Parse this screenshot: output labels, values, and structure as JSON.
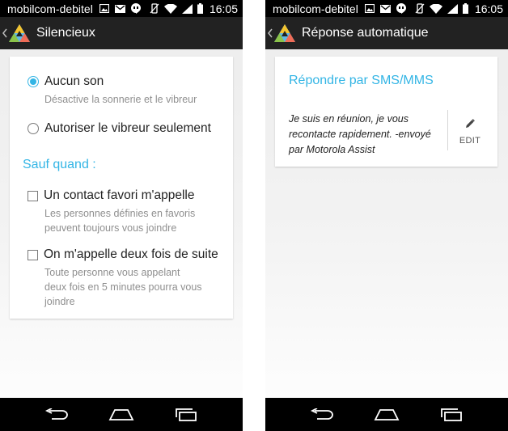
{
  "colors": {
    "accent": "#33b5e5",
    "action_bar": "#222222",
    "status_bar": "#000000"
  },
  "left_screen": {
    "status": {
      "carrier": "mobilcom-debitel",
      "time": "16:05"
    },
    "action_bar": {
      "title": "Silencieux"
    },
    "options": [
      {
        "label": "Aucun son",
        "description": "Désactive la sonnerie et le vibreur",
        "selected": true
      },
      {
        "label": "Autoriser le vibreur seulement",
        "description": "",
        "selected": false
      }
    ],
    "section_title": "Sauf quand :",
    "exceptions": [
      {
        "label": "Un contact favori m'appelle",
        "description": "Les personnes définies en favoris\npeuvent toujours vous joindre",
        "checked": false
      },
      {
        "label": "On m'appelle deux fois de suite",
        "description": "Toute personne vous appelant\ndeux fois en 5 minutes pourra vous\njoindre",
        "checked": false
      }
    ]
  },
  "right_screen": {
    "status": {
      "carrier": "mobilcom-debitel",
      "time": "16:05"
    },
    "action_bar": {
      "title": "Réponse automatique"
    },
    "card": {
      "title": "Répondre par SMS/MMS",
      "message": "Je suis en réunion, je vous recontacte rapidement. -envoyé par Motorola Assist",
      "edit_label": "EDIT"
    }
  },
  "icons": {
    "status_left": [
      "image-icon",
      "gmail-icon",
      "hangouts-icon"
    ],
    "status_right": [
      "vibrate-off-icon",
      "wifi-icon",
      "signal-icon",
      "battery-icon"
    ],
    "nav": [
      "back-icon",
      "home-icon",
      "recents-icon"
    ]
  }
}
